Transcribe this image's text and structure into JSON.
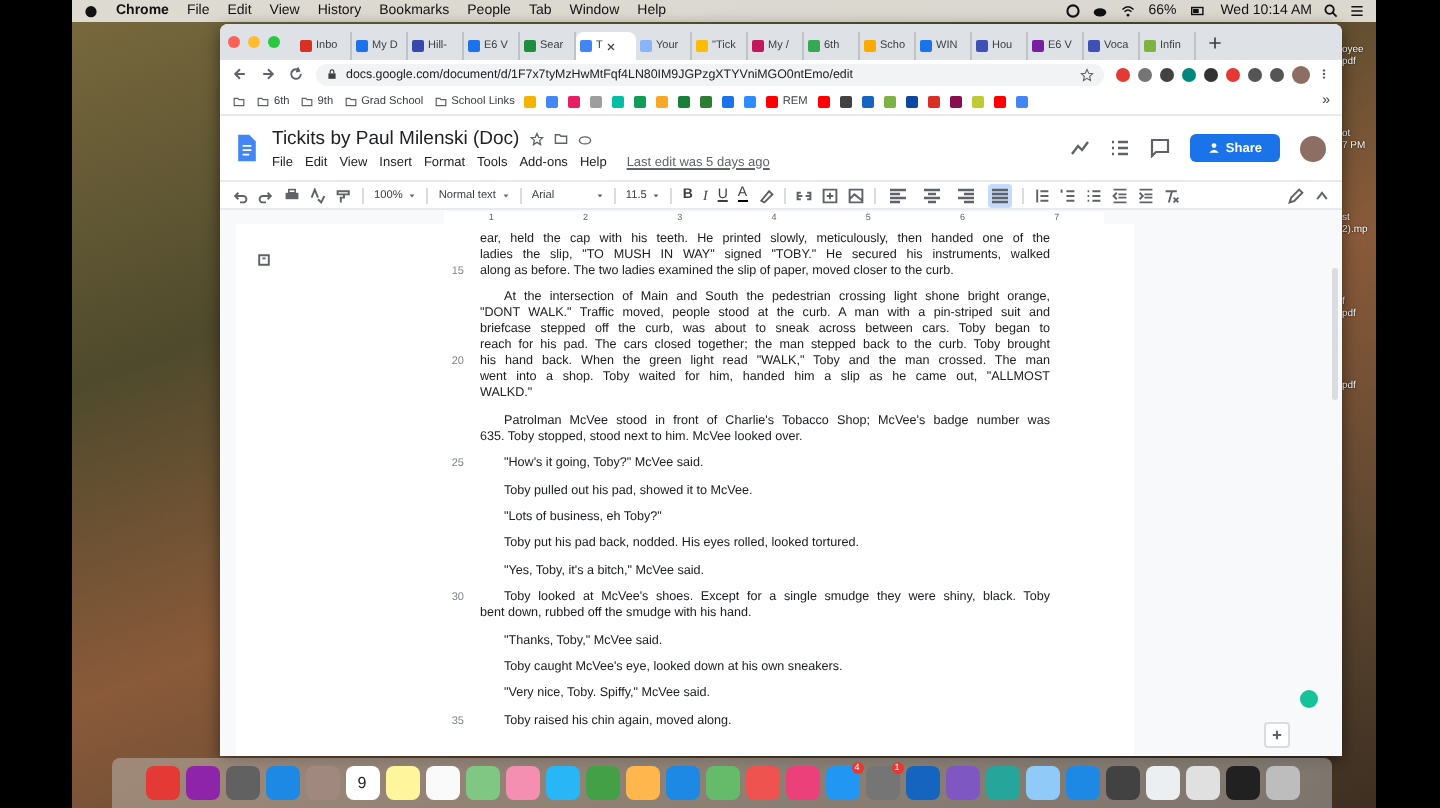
{
  "menu_bar": {
    "app": "Chrome",
    "items": [
      "File",
      "Edit",
      "View",
      "History",
      "Bookmarks",
      "People",
      "Tab",
      "Window",
      "Help"
    ],
    "battery": "66%",
    "clock": "Wed 10:14 AM"
  },
  "tabs": [
    {
      "label": "Inbo",
      "color": "#d93025",
      "selected": false
    },
    {
      "label": "My D",
      "color": "#1a73e8",
      "selected": false
    },
    {
      "label": "Hill-",
      "color": "#3949ab",
      "selected": false
    },
    {
      "label": "E6 V",
      "color": "#1a73e8",
      "selected": false
    },
    {
      "label": "Sear",
      "color": "#1e8e3e",
      "selected": false
    },
    {
      "label": "T",
      "color": "#4285f4",
      "selected": true
    },
    {
      "label": "Your",
      "color": "#8ab4f8",
      "selected": false
    },
    {
      "label": "\"Tick",
      "color": "#fbbc04",
      "selected": false
    },
    {
      "label": "My /",
      "color": "#c2185b",
      "selected": false
    },
    {
      "label": "6th",
      "color": "#34a853",
      "selected": false
    },
    {
      "label": "Scho",
      "color": "#f9ab00",
      "selected": false
    },
    {
      "label": "WIN",
      "color": "#1a73e8",
      "selected": false
    },
    {
      "label": "Hou",
      "color": "#3f51b5",
      "selected": false
    },
    {
      "label": "E6 V",
      "color": "#7b1fa2",
      "selected": false
    },
    {
      "label": "Voca",
      "color": "#3f51b5",
      "selected": false
    },
    {
      "label": "Infin",
      "color": "#7cb342",
      "selected": false
    }
  ],
  "address_bar": {
    "url": "docs.google.com/document/d/1F7x7tyMzHwMtFqf4LN80IM9JGPzgXTYVniMGO0ntEmo/edit"
  },
  "bookmarks": [
    {
      "kind": "folder"
    },
    {
      "kind": "folder",
      "label": "6th"
    },
    {
      "kind": "folder",
      "label": "9th"
    },
    {
      "kind": "folder",
      "label": "Grad School"
    },
    {
      "kind": "folder",
      "label": "School Links"
    },
    {
      "kind": "site",
      "color": "#f4b400"
    },
    {
      "kind": "site",
      "color": "#4285f4"
    },
    {
      "kind": "site",
      "color": "#e91e63"
    },
    {
      "kind": "site",
      "color": "#9e9e9e"
    },
    {
      "kind": "site",
      "color": "#00bfa5"
    },
    {
      "kind": "site",
      "color": "#0f9d58"
    },
    {
      "kind": "site",
      "color": "#f9a825"
    },
    {
      "kind": "site",
      "color": "#188038"
    },
    {
      "kind": "site",
      "color": "#2e7d32"
    },
    {
      "kind": "site",
      "color": "#1a73e8"
    },
    {
      "kind": "site",
      "color": "#2d8cff"
    },
    {
      "kind": "site",
      "color": "#ff0000",
      "label": "REM"
    },
    {
      "kind": "site",
      "color": "#ff0000"
    },
    {
      "kind": "site",
      "color": "#424242"
    },
    {
      "kind": "site",
      "color": "#1565c0"
    },
    {
      "kind": "site",
      "color": "#7cb342"
    },
    {
      "kind": "site",
      "color": "#0d47a1"
    },
    {
      "kind": "site",
      "color": "#d93025"
    },
    {
      "kind": "site",
      "color": "#880e4f"
    },
    {
      "kind": "site",
      "color": "#c0ca33"
    },
    {
      "kind": "site",
      "color": "#ff0000"
    },
    {
      "kind": "site",
      "color": "#4285f4"
    }
  ],
  "bookmarks_more": "»",
  "docs_header": {
    "title": "Tickits by Paul Milenski (Doc)",
    "menu": [
      "File",
      "Edit",
      "View",
      "Insert",
      "Format",
      "Tools",
      "Add-ons",
      "Help"
    ],
    "last_edit": "Last edit was 5 days ago",
    "share": "Share"
  },
  "toolbar": {
    "zoom": "100%",
    "style": "Normal text",
    "font": "Arial",
    "size": "11.5",
    "bold": "B",
    "italic": "I",
    "underline": "U",
    "text_color": "A",
    "alignments": [
      {
        "kind": "left",
        "selected": false
      },
      {
        "kind": "center",
        "selected": false
      },
      {
        "kind": "right",
        "selected": false
      },
      {
        "kind": "justify",
        "selected": true
      }
    ]
  },
  "ruler": [
    "1",
    "2",
    "3",
    "4",
    "5",
    "6",
    "7"
  ],
  "paragraphs": [
    {
      "indent": false,
      "lines": [
        {
          "text": "ear, held the cap with his teeth. He printed slowly, meticulously, then handed one of the"
        },
        {
          "text": "ladies the slip, \"TO MUSH IN WAY\" signed \"TOBY.\" He secured his instruments, walked"
        },
        {
          "text": "along as before. The two ladies examined the slip of paper, moved closer to the curb.",
          "line_number": "15"
        }
      ]
    },
    {
      "indent": true,
      "lines": [
        {
          "text": "At the intersection of Main and South the pedestrian crossing light shone bright orange,"
        },
        {
          "text": "\"DONT WALK.\" Traffic moved, people stood at the curb. A man with a pin-striped suit and"
        },
        {
          "text": "briefcase stepped off the curb, was about to sneak across between cars. Toby began to"
        },
        {
          "text": "reach for his pad. The cars closed together; the man stepped back to the curb. Toby brought"
        },
        {
          "text": "his hand back. When the green light read \"WALK,\" Toby and the man crossed. The man",
          "line_number": "20"
        },
        {
          "text": "went into a shop. Toby waited for him, handed him a slip as he came out, \"ALLMOST"
        },
        {
          "text": "WALKD.\""
        }
      ]
    },
    {
      "indent": true,
      "lines": [
        {
          "text": "Patrolman McVee stood in front of Charlie's Tobacco Shop; McVee's badge number was"
        },
        {
          "text": "635. Toby stopped, stood next to him. McVee looked over."
        }
      ]
    },
    {
      "indent": true,
      "lines": [
        {
          "text": "\"How's it going, Toby?\" McVee said.",
          "line_number": "25"
        }
      ]
    },
    {
      "indent": true,
      "lines": [
        {
          "text": "Toby pulled out his pad, showed it to McVee."
        }
      ]
    },
    {
      "indent": true,
      "lines": [
        {
          "text": "\"Lots of business, eh Toby?\""
        }
      ]
    },
    {
      "indent": true,
      "lines": [
        {
          "text": "Toby put his pad back, nodded. His eyes rolled, looked tortured."
        }
      ]
    },
    {
      "indent": true,
      "lines": [
        {
          "text": "\"Yes, Toby, it's a bitch,\" McVee said."
        }
      ]
    },
    {
      "indent": true,
      "lines": [
        {
          "text": "Toby looked at McVee's shoes. Except for a single smudge they were shiny, black. Toby",
          "line_number": "30"
        },
        {
          "text": "bent down, rubbed off the smudge with his hand."
        }
      ]
    },
    {
      "indent": true,
      "lines": [
        {
          "text": "\"Thanks, Toby,\" McVee said."
        }
      ]
    },
    {
      "indent": true,
      "lines": [
        {
          "text": "Toby caught McVee's eye, looked down at his own sneakers."
        }
      ]
    },
    {
      "indent": true,
      "lines": [
        {
          "text": "\"Very nice, Toby. Spiffy,\" McVee said."
        }
      ]
    },
    {
      "indent": true,
      "lines": [
        {
          "text": "Toby raised his chin again, moved along.",
          "line_number": "35"
        }
      ]
    }
  ],
  "desktop_files": [
    {
      "lines": [
        "oyee",
        "pdf"
      ]
    },
    {
      "lines": [
        "ot",
        "7 PM"
      ]
    },
    {
      "lines": [
        "st",
        "2).mp"
      ]
    },
    {
      "lines": [
        "f",
        "pdf"
      ]
    },
    {
      "lines": [
        "pdf"
      ]
    }
  ],
  "dock": [
    {
      "color": "#e53935"
    },
    {
      "color": "#8e24aa"
    },
    {
      "color": "#616161"
    },
    {
      "color": "#1e88e5"
    },
    {
      "color": "#a1887f"
    },
    {
      "color": "#ffffff",
      "label": "9"
    },
    {
      "color": "#fff59d"
    },
    {
      "color": "#fafafa"
    },
    {
      "color": "#81c784"
    },
    {
      "color": "#f48fb1"
    },
    {
      "color": "#29b6f6"
    },
    {
      "color": "#43a047"
    },
    {
      "color": "#ffb74d"
    },
    {
      "color": "#1e88e5"
    },
    {
      "color": "#66bb6a"
    },
    {
      "color": "#ef5350"
    },
    {
      "color": "#ec407a"
    },
    {
      "color": "#2196f3",
      "badge": "4"
    },
    {
      "color": "#757575",
      "badge": "1"
    },
    {
      "color": "#1565c0"
    },
    {
      "color": "#7e57c2"
    },
    {
      "color": "#26a69a"
    },
    {
      "color": "#90caf9"
    },
    {
      "color": "#1e88e5"
    },
    {
      "color": "#424242"
    },
    {
      "color": "#eceff1"
    },
    {
      "color": "#e0e0e0"
    },
    {
      "color": "#212121"
    },
    {
      "color": "#bdbdbd"
    }
  ]
}
